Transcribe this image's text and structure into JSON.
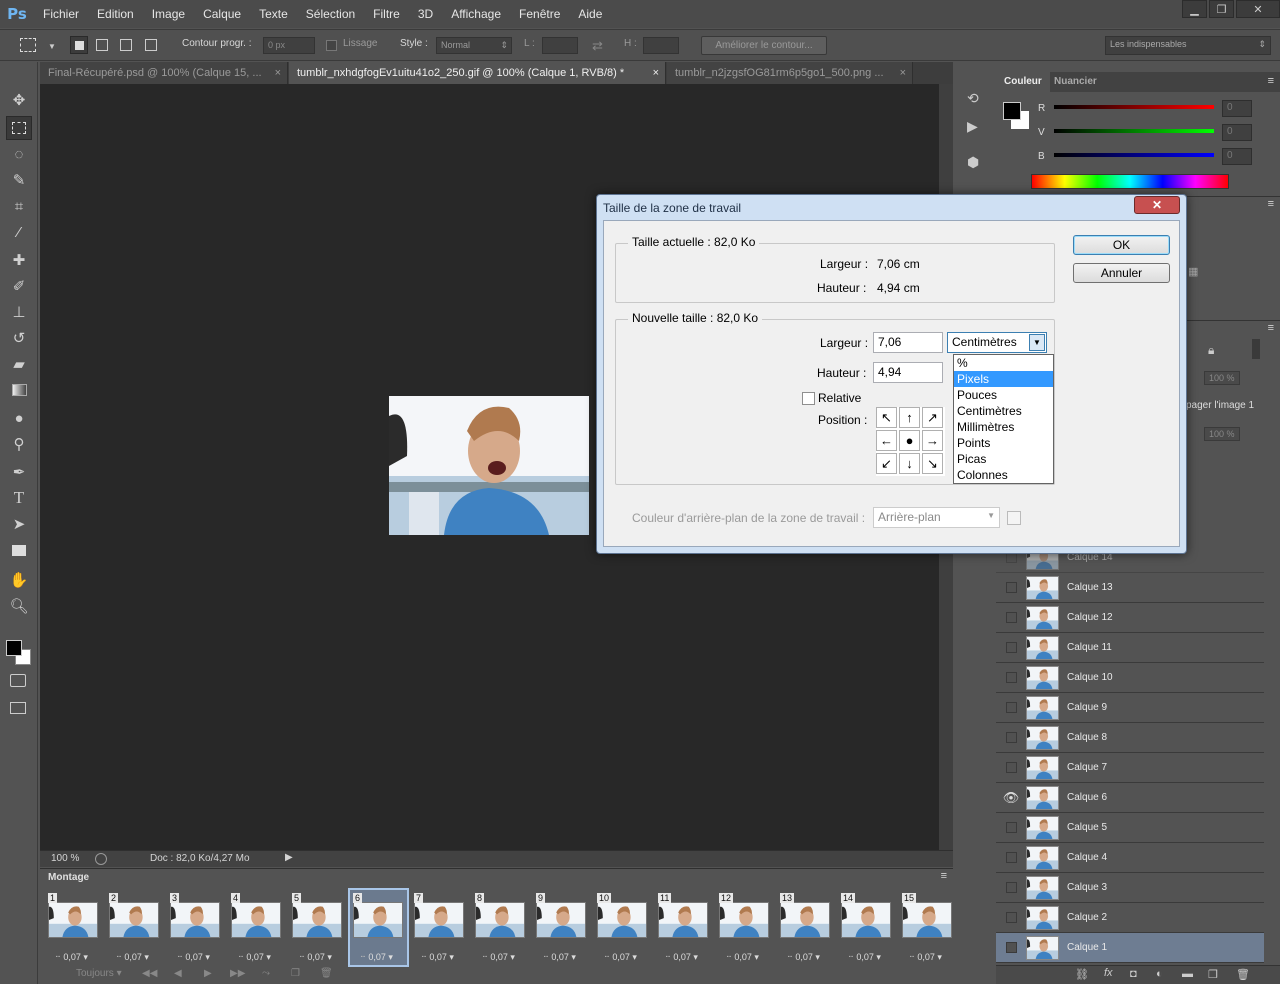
{
  "app": {
    "logo": "Ps"
  },
  "menu": [
    "Fichier",
    "Edition",
    "Image",
    "Calque",
    "Texte",
    "Sélection",
    "Filtre",
    "3D",
    "Affichage",
    "Fenêtre",
    "Aide"
  ],
  "options": {
    "feather_label": "Contour progr. :",
    "feather_value": "0 px",
    "smooth_label": "Lissage",
    "style_label": "Style :",
    "style_value": "Normal",
    "width_label": "L :",
    "height_label": "H :",
    "refine_label": "Améliorer le contour...",
    "workspace": "Les indispensables"
  },
  "tabs": [
    "Final-Récupéré.psd @ 100% (Calque 15, ...",
    "tumblr_nxhdgfogEv1uitu41o2_250.gif @ 100% (Calque 1, RVB/8) *",
    "tumblr_n2jzgsfOG81rm6p5go1_500.png ..."
  ],
  "status": {
    "zoom": "100 %",
    "doc": "Doc : 82,0 Ko/4,27 Mo"
  },
  "montage": {
    "title": "Montage",
    "loop": "Toujours",
    "frames": [
      {
        "n": "1",
        "d": "0,07"
      },
      {
        "n": "2",
        "d": "0,07"
      },
      {
        "n": "3",
        "d": "0,07"
      },
      {
        "n": "4",
        "d": "0,07"
      },
      {
        "n": "5",
        "d": "0,07"
      },
      {
        "n": "6",
        "d": "0,07"
      },
      {
        "n": "7",
        "d": "0,07"
      },
      {
        "n": "8",
        "d": "0,07"
      },
      {
        "n": "9",
        "d": "0,07"
      },
      {
        "n": "10",
        "d": "0,07"
      },
      {
        "n": "11",
        "d": "0,07"
      },
      {
        "n": "12",
        "d": "0,07"
      },
      {
        "n": "13",
        "d": "0,07"
      },
      {
        "n": "14",
        "d": "0,07"
      },
      {
        "n": "15",
        "d": "0,07"
      }
    ],
    "selected": "6"
  },
  "color_panel": {
    "tabs": [
      "Couleur",
      "Nuancier"
    ],
    "channels": [
      {
        "label": "R",
        "value": "0"
      },
      {
        "label": "V",
        "value": "0"
      },
      {
        "label": "B",
        "value": "0"
      }
    ]
  },
  "layers_panel": {
    "partial1": "100 %",
    "propagate": "pager l'image 1",
    "partial2": "100 %",
    "layers": [
      "Calque 14",
      "Calque 13",
      "Calque 12",
      "Calque 11",
      "Calque 10",
      "Calque 9",
      "Calque 8",
      "Calque 7",
      "Calque 6",
      "Calque 5",
      "Calque 4",
      "Calque 3",
      "Calque 2",
      "Calque 1"
    ],
    "visible": "Calque 6",
    "selected": "Calque 1"
  },
  "dialog": {
    "title": "Taille de la zone de travail",
    "current_size": "Taille actuelle : 82,0 Ko",
    "cur_width_label": "Largeur :",
    "cur_width": "7,06 cm",
    "cur_height_label": "Hauteur :",
    "cur_height": "4,94 cm",
    "new_size": "Nouvelle taille : 82,0 Ko",
    "width_label": "Largeur :",
    "width_value": "7,06",
    "height_label": "Hauteur :",
    "height_value": "4,94",
    "unit_selected": "Centimètres",
    "unit_options": [
      "%",
      "Pixels",
      "Pouces",
      "Centimètres",
      "Millimètres",
      "Points",
      "Picas",
      "Colonnes"
    ],
    "unit_highlight": "Pixels",
    "relative_label": "Relative",
    "position_label": "Position :",
    "bg_label": "Couleur d'arrière-plan de la zone de travail :",
    "bg_value": "Arrière-plan",
    "ok": "OK",
    "cancel": "Annuler"
  }
}
